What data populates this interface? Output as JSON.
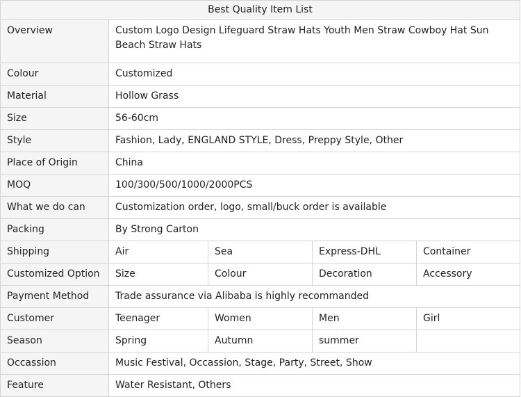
{
  "table": {
    "title": "Best Quality Item List",
    "rows": {
      "overview": {
        "label": "Overview",
        "value": "Custom Logo Design Lifeguard Straw Hats Youth Men Straw Cowboy Hat Sun Beach Straw Hats"
      },
      "colour": {
        "label": "Colour",
        "value": "Customized"
      },
      "material": {
        "label": "Material",
        "value": "Hollow Grass"
      },
      "size": {
        "label": "Size",
        "value": "56-60cm"
      },
      "style": {
        "label": "Style",
        "value": "Fashion, Lady, ENGLAND STYLE, Dress, Preppy Style, Other"
      },
      "origin": {
        "label": "Place of Origin",
        "value": "China"
      },
      "moq": {
        "label": "MOQ",
        "value": "100/300/500/1000/2000PCS"
      },
      "service": {
        "label": "What we do can",
        "value": "Customization order, logo, small/buck order is available"
      },
      "packing": {
        "label": "Packing",
        "value": "By Strong Carton"
      },
      "shipping": {
        "label": "Shipping",
        "values": [
          "Air",
          "Sea",
          "Express-DHL",
          "Container"
        ]
      },
      "customized_option": {
        "label": "Customized Option",
        "values": [
          "Size",
          "Colour",
          "Decoration",
          "Accessory"
        ]
      },
      "payment": {
        "label": "Payment Method",
        "value": "Trade assurance via Alibaba is highly recommanded"
      },
      "customer": {
        "label": "Customer",
        "values": [
          "Teenager",
          "Women",
          "Men",
          "Girl"
        ]
      },
      "season": {
        "label": "Season",
        "values": [
          "Spring",
          "Autumn",
          "summer",
          ""
        ]
      },
      "occasion": {
        "label": "Occassion",
        "value": "Music Festival, Occassion, Stage, Party, Street, Show"
      },
      "feature": {
        "label": "Feature",
        "value": "Water Resistant, Others"
      }
    }
  }
}
